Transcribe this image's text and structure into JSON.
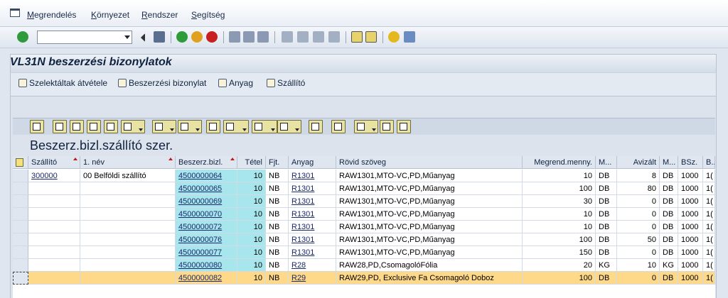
{
  "menu": {
    "items": [
      "Megrendelés",
      "Környezet",
      "Rendszer",
      "Segítség"
    ]
  },
  "toolbar": {
    "command_value": "",
    "icons": [
      "enter-icon",
      "back-icon",
      "save-icon",
      "nav-back-icon",
      "exit-icon",
      "cancel-icon",
      "print-icon",
      "find-icon",
      "find-next-icon",
      "first-page-icon",
      "prev-page-icon",
      "next-page-icon",
      "last-page-icon",
      "new-session-icon",
      "shortcut-icon",
      "help-icon",
      "layout-icon"
    ]
  },
  "title": "VL31N beszerzési bizonylatok",
  "app_toolbar": {
    "buttons": [
      "Szelektáltak átvétele",
      "Beszerzési bizonylat",
      "Anyag",
      "Szállító"
    ]
  },
  "list_title": "Beszerz.bizl.szállító szer.",
  "grid": {
    "columns": [
      "Szállító",
      "1. név",
      "Beszerz.bizl.",
      "Tétel",
      "Fjt.",
      "Anyag",
      "Rövid szöveg",
      "Megrend.menny.",
      "M...",
      "Avizált",
      "M...",
      "BSz.",
      "B..."
    ],
    "rows": [
      [
        "300000",
        "00 Belföldi szállító",
        "4500000064",
        "10",
        "NB",
        "R1301",
        "RAW1301,MTO-VC,PD,Műanyag",
        "10",
        "DB",
        "8",
        "DB",
        "1000",
        "1("
      ],
      [
        "",
        "",
        "4500000065",
        "10",
        "NB",
        "R1301",
        "RAW1301,MTO-VC,PD,Műanyag",
        "100",
        "DB",
        "80",
        "DB",
        "1000",
        "1("
      ],
      [
        "",
        "",
        "4500000069",
        "10",
        "NB",
        "R1301",
        "RAW1301,MTO-VC,PD,Műanyag",
        "30",
        "DB",
        "0",
        "DB",
        "1000",
        "1("
      ],
      [
        "",
        "",
        "4500000070",
        "10",
        "NB",
        "R1301",
        "RAW1301,MTO-VC,PD,Műanyag",
        "10",
        "DB",
        "0",
        "DB",
        "1000",
        "1("
      ],
      [
        "",
        "",
        "4500000072",
        "10",
        "NB",
        "R1301",
        "RAW1301,MTO-VC,PD,Műanyag",
        "10",
        "DB",
        "0",
        "DB",
        "1000",
        "1("
      ],
      [
        "",
        "",
        "4500000076",
        "10",
        "NB",
        "R1301",
        "RAW1301,MTO-VC,PD,Műanyag",
        "100",
        "DB",
        "50",
        "DB",
        "1000",
        "1("
      ],
      [
        "",
        "",
        "4500000077",
        "10",
        "NB",
        "R1301",
        "RAW1301,MTO-VC,PD,Műanyag",
        "150",
        "DB",
        "0",
        "DB",
        "1000",
        "1("
      ],
      [
        "",
        "",
        "4500000080",
        "10",
        "NB",
        "R28",
        "RAW28,PD,CsomagolóFólia",
        "20",
        "KG",
        "10",
        "KG",
        "1000",
        "1("
      ],
      [
        "",
        "",
        "4500000082",
        "10",
        "NB",
        "R29",
        "RAW29,PD, Exclusive Fa Csomagoló Doboz",
        "100",
        "DB",
        "0",
        "DB",
        "1000",
        "1("
      ]
    ]
  },
  "colors": {
    "highlight_row": "#ffd98a",
    "key_column": "#a8e6ee",
    "sort_marker": "#c21a1a"
  }
}
